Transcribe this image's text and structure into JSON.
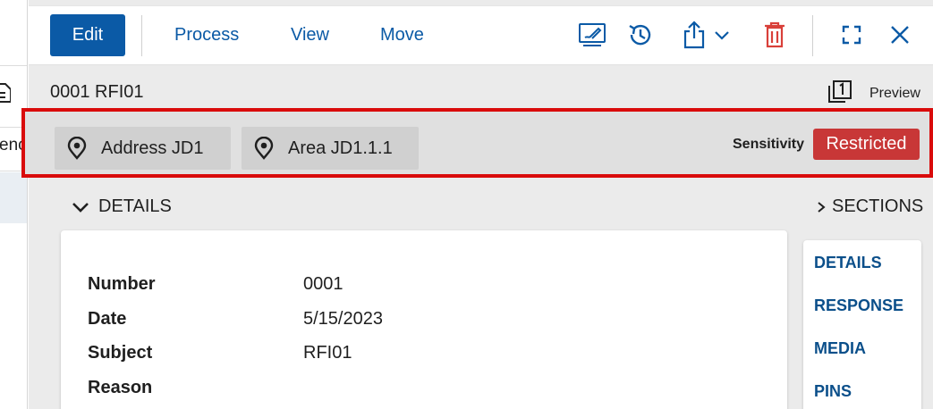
{
  "left_panel": {
    "partial_text": "enc"
  },
  "toolbar": {
    "edit_label": "Edit",
    "menu": [
      "Process",
      "View",
      "Move"
    ],
    "icons": [
      "signature-icon",
      "history-icon",
      "share-icon",
      "chevron-down-icon",
      "delete-icon",
      "expand-icon",
      "close-icon"
    ]
  },
  "record": {
    "title": "0001 RFI01",
    "preview_label": "Preview"
  },
  "tags": {
    "locations": [
      "Address JD1",
      "Area JD1.1.1"
    ],
    "sensitivity_label": "Sensitivity",
    "sensitivity_value": "Restricted"
  },
  "details": {
    "heading": "DETAILS",
    "fields": [
      {
        "label": "Number",
        "value": "0001"
      },
      {
        "label": "Date",
        "value": "5/15/2023"
      },
      {
        "label": "Subject",
        "value": "RFI01"
      },
      {
        "label": "Reason",
        "value": ""
      }
    ]
  },
  "sections": {
    "heading": "SECTIONS",
    "links": [
      "DETAILS",
      "RESPONSE",
      "MEDIA",
      "PINS"
    ]
  },
  "colors": {
    "primary": "#0b5aa6",
    "danger": "#c83737",
    "highlight": "#d90b0b",
    "link": "#0b4f8a"
  }
}
